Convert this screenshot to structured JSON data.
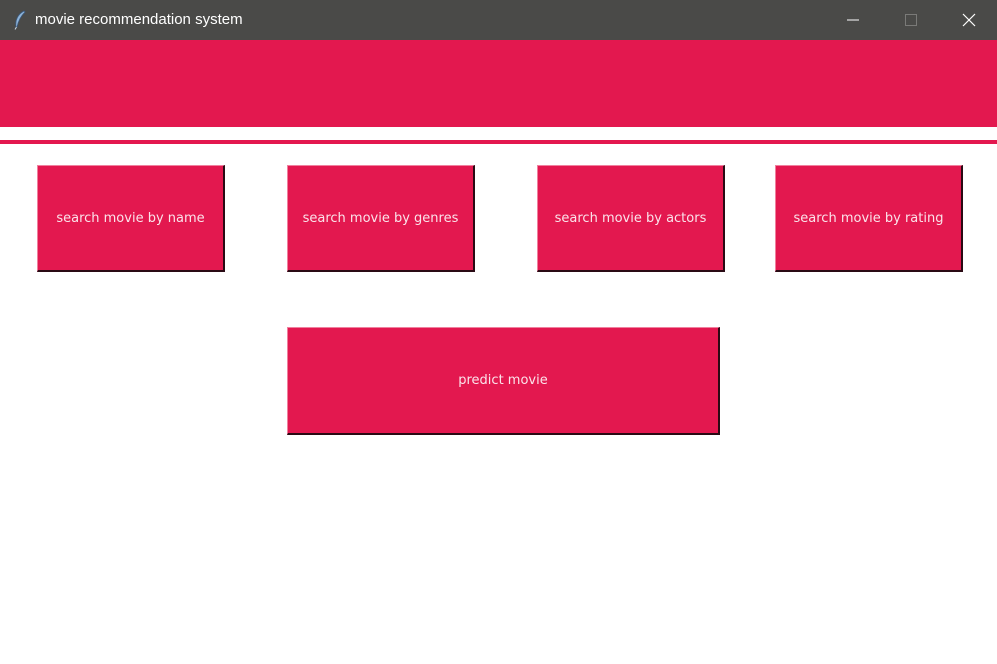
{
  "window": {
    "title": "movie recommendation system",
    "app_icon": "feather-icon",
    "controls": {
      "minimize_icon": "minimize-icon",
      "maximize_icon": "maximize-icon",
      "close_icon": "close-icon"
    }
  },
  "colors": {
    "titlebar": "#4a4a48",
    "accent": "#e3184f",
    "button_text": "#fbe3ea",
    "background": "#ffffff"
  },
  "buttons": {
    "search_by_name": "search movie by name",
    "search_by_genres": "search movie by genres",
    "search_by_actors": "search movie by actors",
    "search_by_rating": "search movie by rating",
    "predict": "predict movie"
  }
}
